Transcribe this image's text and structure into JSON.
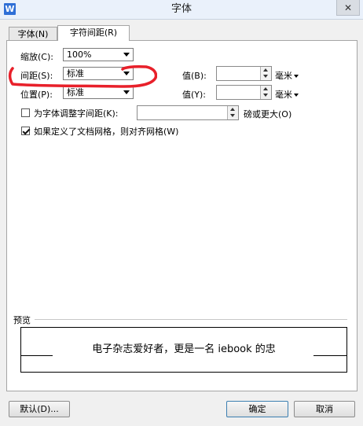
{
  "window": {
    "title": "字体",
    "app_icon": "W",
    "close_symbol": "✕"
  },
  "tabs": [
    {
      "label": "字体(N)",
      "active": false
    },
    {
      "label": "字符间距(R)",
      "active": true
    }
  ],
  "fields": {
    "scale": {
      "label": "缩放(C):",
      "value": "100%"
    },
    "spacing": {
      "label": "间距(S):",
      "value": "标准",
      "amount_label": "值(B):",
      "unit": "毫米"
    },
    "position": {
      "label": "位置(P):",
      "value": "标准",
      "amount_label": "值(Y):",
      "unit": "毫米"
    },
    "kerning": {
      "label": "为字体调整字间距(K):",
      "checked": false,
      "suffix": "磅或更大(O)"
    },
    "grid": {
      "label": "如果定义了文档网格，则对齐网格(W)",
      "checked": true
    }
  },
  "preview": {
    "label": "预览",
    "text": "电子杂志爱好者，更是一名 iebook 的忠"
  },
  "buttons": {
    "default": "默认(D)...",
    "ok": "确定",
    "cancel": "取消"
  },
  "colors": {
    "annotation": "#e8202a",
    "accent": "#2f6fd6"
  }
}
